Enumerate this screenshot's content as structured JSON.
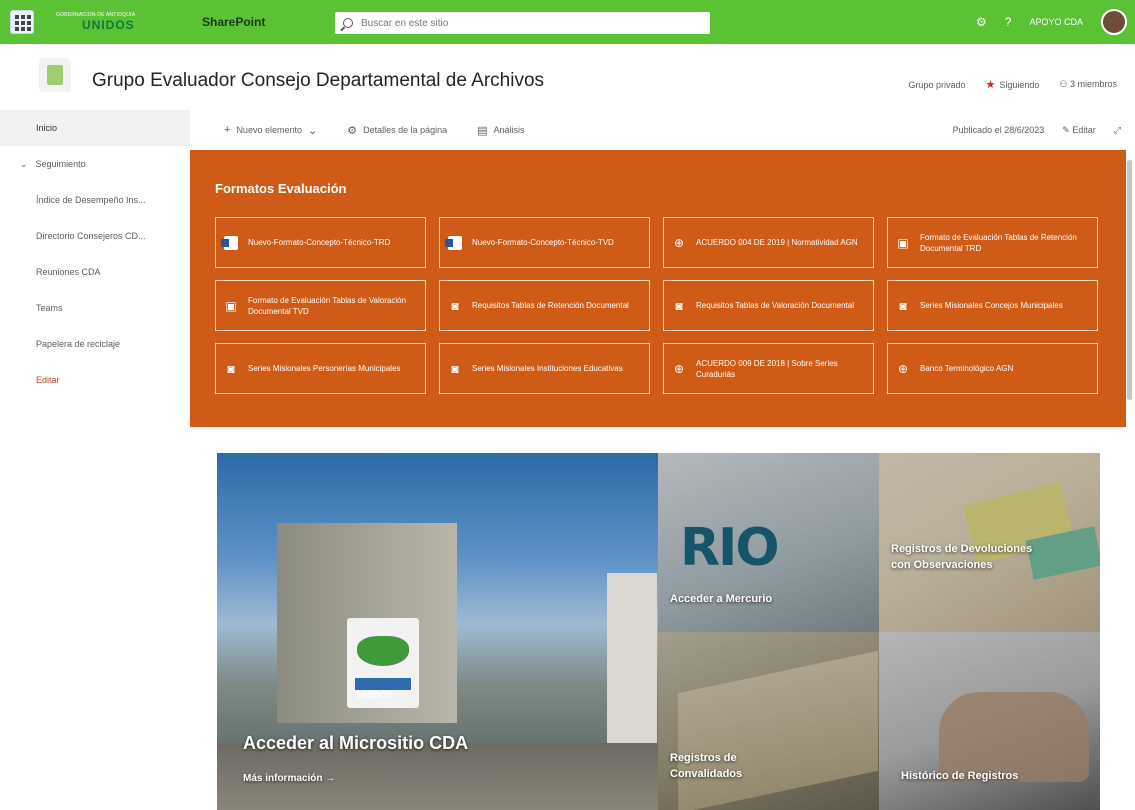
{
  "suite": {
    "org_line": "GOBERNACIÓN DE ANTIOQUIA",
    "org_name": "UNIDOS",
    "app_name": "SharePoint",
    "search_placeholder": "Buscar en este sitio",
    "settings_icon": "gear-icon",
    "help_label": "?",
    "user_name": "APOYO CDA"
  },
  "site": {
    "title": "Grupo Evaluador Consejo Departamental de Archivos",
    "privacy": "Grupo privado",
    "following": "Siguiendo",
    "members": "3 miembros"
  },
  "nav": {
    "items": [
      {
        "label": "Inicio"
      },
      {
        "label": "Seguimiento"
      },
      {
        "label": "Índice de Desempeño Ins..."
      },
      {
        "label": "Directorio Consejeros CD..."
      },
      {
        "label": "Reuniones CDA"
      },
      {
        "label": "Teams"
      },
      {
        "label": "Papelera de reciclaje"
      },
      {
        "label": "Editar"
      }
    ]
  },
  "commands": {
    "new_item": "Nuevo elemento",
    "page_details": "Detalles de la página",
    "analytics": "Análisis",
    "published": "Publicado el 28/6/2023",
    "edit": "Editar"
  },
  "formats": {
    "title": "Formatos Evaluación",
    "tiles": [
      {
        "label": "Nuevo-Formato-Concepto-Técnico-TRD",
        "icon": "word-doc-icon"
      },
      {
        "label": "Nuevo-Formato-Concepto-Técnico-TVD",
        "icon": "word-doc-icon"
      },
      {
        "label": "ACUERDO 004 DE 2019 | Normatividad AGN",
        "icon": "globe-icon"
      },
      {
        "label": "Formato de Evaluación Tablas de Retención Documental TRD",
        "icon": "document-icon"
      },
      {
        "label": "Formato de Evaluación Tablas de Valoración Documental TVD",
        "icon": "document-icon"
      },
      {
        "label": "Requisitos Tablas de Retención Documental",
        "icon": "pdf-icon"
      },
      {
        "label": "Requisitos Tablas de Valoración Documental",
        "icon": "pdf-icon"
      },
      {
        "label": "Series Misionales Concejos Municipales",
        "icon": "pdf-icon"
      },
      {
        "label": "Series Misionales Personerías Municipales",
        "icon": "pdf-icon"
      },
      {
        "label": "Series Misionales Instituciones Educativas",
        "icon": "pdf-icon"
      },
      {
        "label": "ACUERDO 009 DE 2018 | Sobre Series Curaduriás",
        "icon": "globe-icon"
      },
      {
        "label": "Banco Terminológico AGN",
        "icon": "globe-icon"
      }
    ]
  },
  "hero": {
    "main_title": "Acceder al Micrositio CDA",
    "main_link": "Más información →",
    "tile1": "Acceder a Mercurio",
    "tile1_image_text": "RIO",
    "tile2": "Registros de Devoluciones con Observaciones",
    "tile3": "Registros de Convalidados",
    "tile4": "Histórico de Registros",
    "sign_text": "UNIDOS"
  }
}
